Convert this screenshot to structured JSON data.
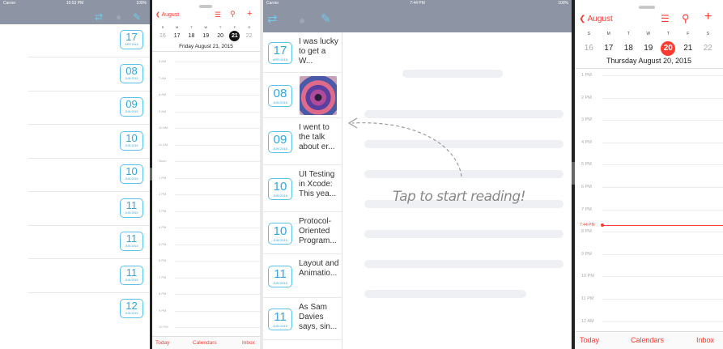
{
  "panel1": {
    "status": {
      "carrier": "Carrier",
      "time": "10:53 PM",
      "battery": "100%"
    },
    "icons": {
      "edit": "✎",
      "circle": "●",
      "sync": "⇄"
    },
    "badges": [
      {
        "day": "17",
        "month": "APR 2015"
      },
      {
        "day": "08",
        "month": "JUN 2015"
      },
      {
        "day": "09",
        "month": "JUN 2015"
      },
      {
        "day": "10",
        "month": "JUN 2015"
      },
      {
        "day": "10",
        "month": "JUN 2015"
      },
      {
        "day": "11",
        "month": "JUN 2015"
      },
      {
        "day": "11",
        "month": "JUN 2015"
      },
      {
        "day": "11",
        "month": "JUN 2015"
      },
      {
        "day": "12",
        "month": "JUN 2015"
      }
    ]
  },
  "cal1": {
    "back": "August",
    "weekdays": [
      "S",
      "M",
      "T",
      "W",
      "T",
      "F",
      "S"
    ],
    "days": [
      "16",
      "17",
      "18",
      "19",
      "20",
      "21",
      "22"
    ],
    "selected": "21",
    "date_title": "Friday  August 21, 2015",
    "hours": [
      "6 AM",
      "7 AM",
      "8 AM",
      "9 AM",
      "10 AM",
      "11 AM",
      "Noon",
      "1 PM",
      "2 PM",
      "3 PM",
      "4 PM",
      "5 PM",
      "6 PM",
      "7 PM",
      "8 PM",
      "9 PM",
      "10 PM"
    ],
    "tabs": {
      "today": "Today",
      "calendars": "Calendars",
      "inbox": "Inbox"
    }
  },
  "panel3": {
    "status": {
      "carrier": "Carrier",
      "time": "7:44 PM",
      "battery": "100%"
    },
    "items": [
      {
        "day": "17",
        "month": "APR 2015",
        "title": "I was lucky to get a W..."
      },
      {
        "day": "08",
        "month": "JUN 2015",
        "title": ""
      },
      {
        "day": "09",
        "month": "JUN 2015",
        "title": "I went to the talk about er..."
      },
      {
        "day": "10",
        "month": "JUN 2015",
        "title": "UI Testing in Xcode: This yea..."
      },
      {
        "day": "10",
        "month": "JUN 2015",
        "title": "Protocol-Oriented Program..."
      },
      {
        "day": "11",
        "month": "JUN 2015",
        "title": "Layout and Animatio..."
      },
      {
        "day": "11",
        "month": "JUN 2015",
        "title": "As Sam Davies says, sin..."
      }
    ],
    "hint": "Tap to start reading!"
  },
  "cal2": {
    "back": "August",
    "weekdays": [
      "S",
      "M",
      "T",
      "W",
      "T",
      "F",
      "S"
    ],
    "days": [
      "16",
      "17",
      "18",
      "19",
      "20",
      "21",
      "22"
    ],
    "selected": "20",
    "date_title": "Thursday  August 20, 2015",
    "hours": [
      "1 PM",
      "2 PM",
      "3 PM",
      "4 PM",
      "5 PM",
      "6 PM",
      "7 PM",
      "8 PM",
      "9 PM",
      "10 PM",
      "11 PM",
      "12 AM"
    ],
    "now": "7:44 PM",
    "tabs": {
      "today": "Today",
      "calendars": "Calendars",
      "inbox": "Inbox"
    }
  }
}
